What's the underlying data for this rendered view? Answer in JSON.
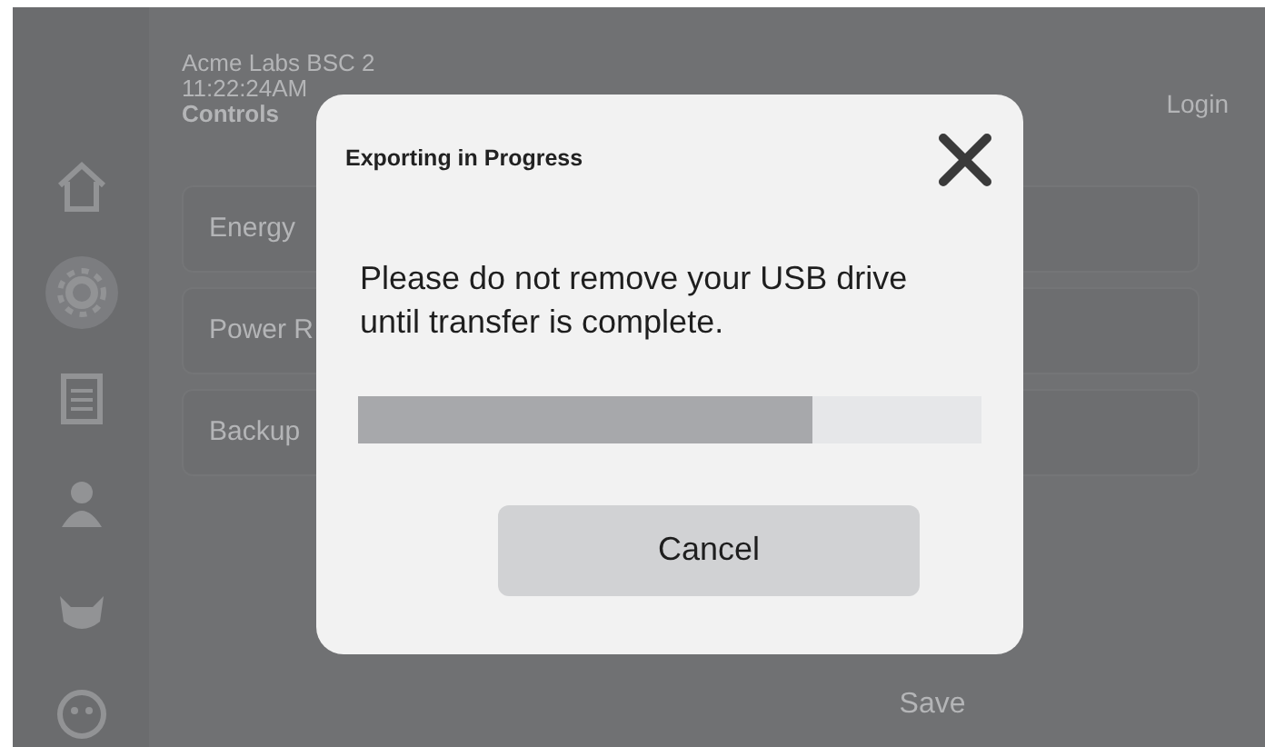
{
  "sidebar": {
    "items": [
      {
        "kind": "home",
        "selected": false
      },
      {
        "kind": "gear",
        "selected": true
      },
      {
        "kind": "clipboard",
        "selected": false
      },
      {
        "kind": "person",
        "selected": false
      },
      {
        "kind": "animal",
        "selected": false
      },
      {
        "kind": "face",
        "selected": false
      }
    ]
  },
  "header": {
    "device": "Acme Labs BSC 2",
    "time": "11:22:24AM",
    "section": "Controls",
    "login": "Login"
  },
  "settings": [
    {
      "label": "Energy"
    },
    {
      "label": "Power R"
    },
    {
      "label": "Backup"
    }
  ],
  "save_button": "Save",
  "dialog": {
    "title": "Exporting in Progress",
    "message": "Please do not remove your USB drive until transfer is complete.",
    "progress": {
      "level": 0.73
    },
    "cancel": "Cancel"
  }
}
